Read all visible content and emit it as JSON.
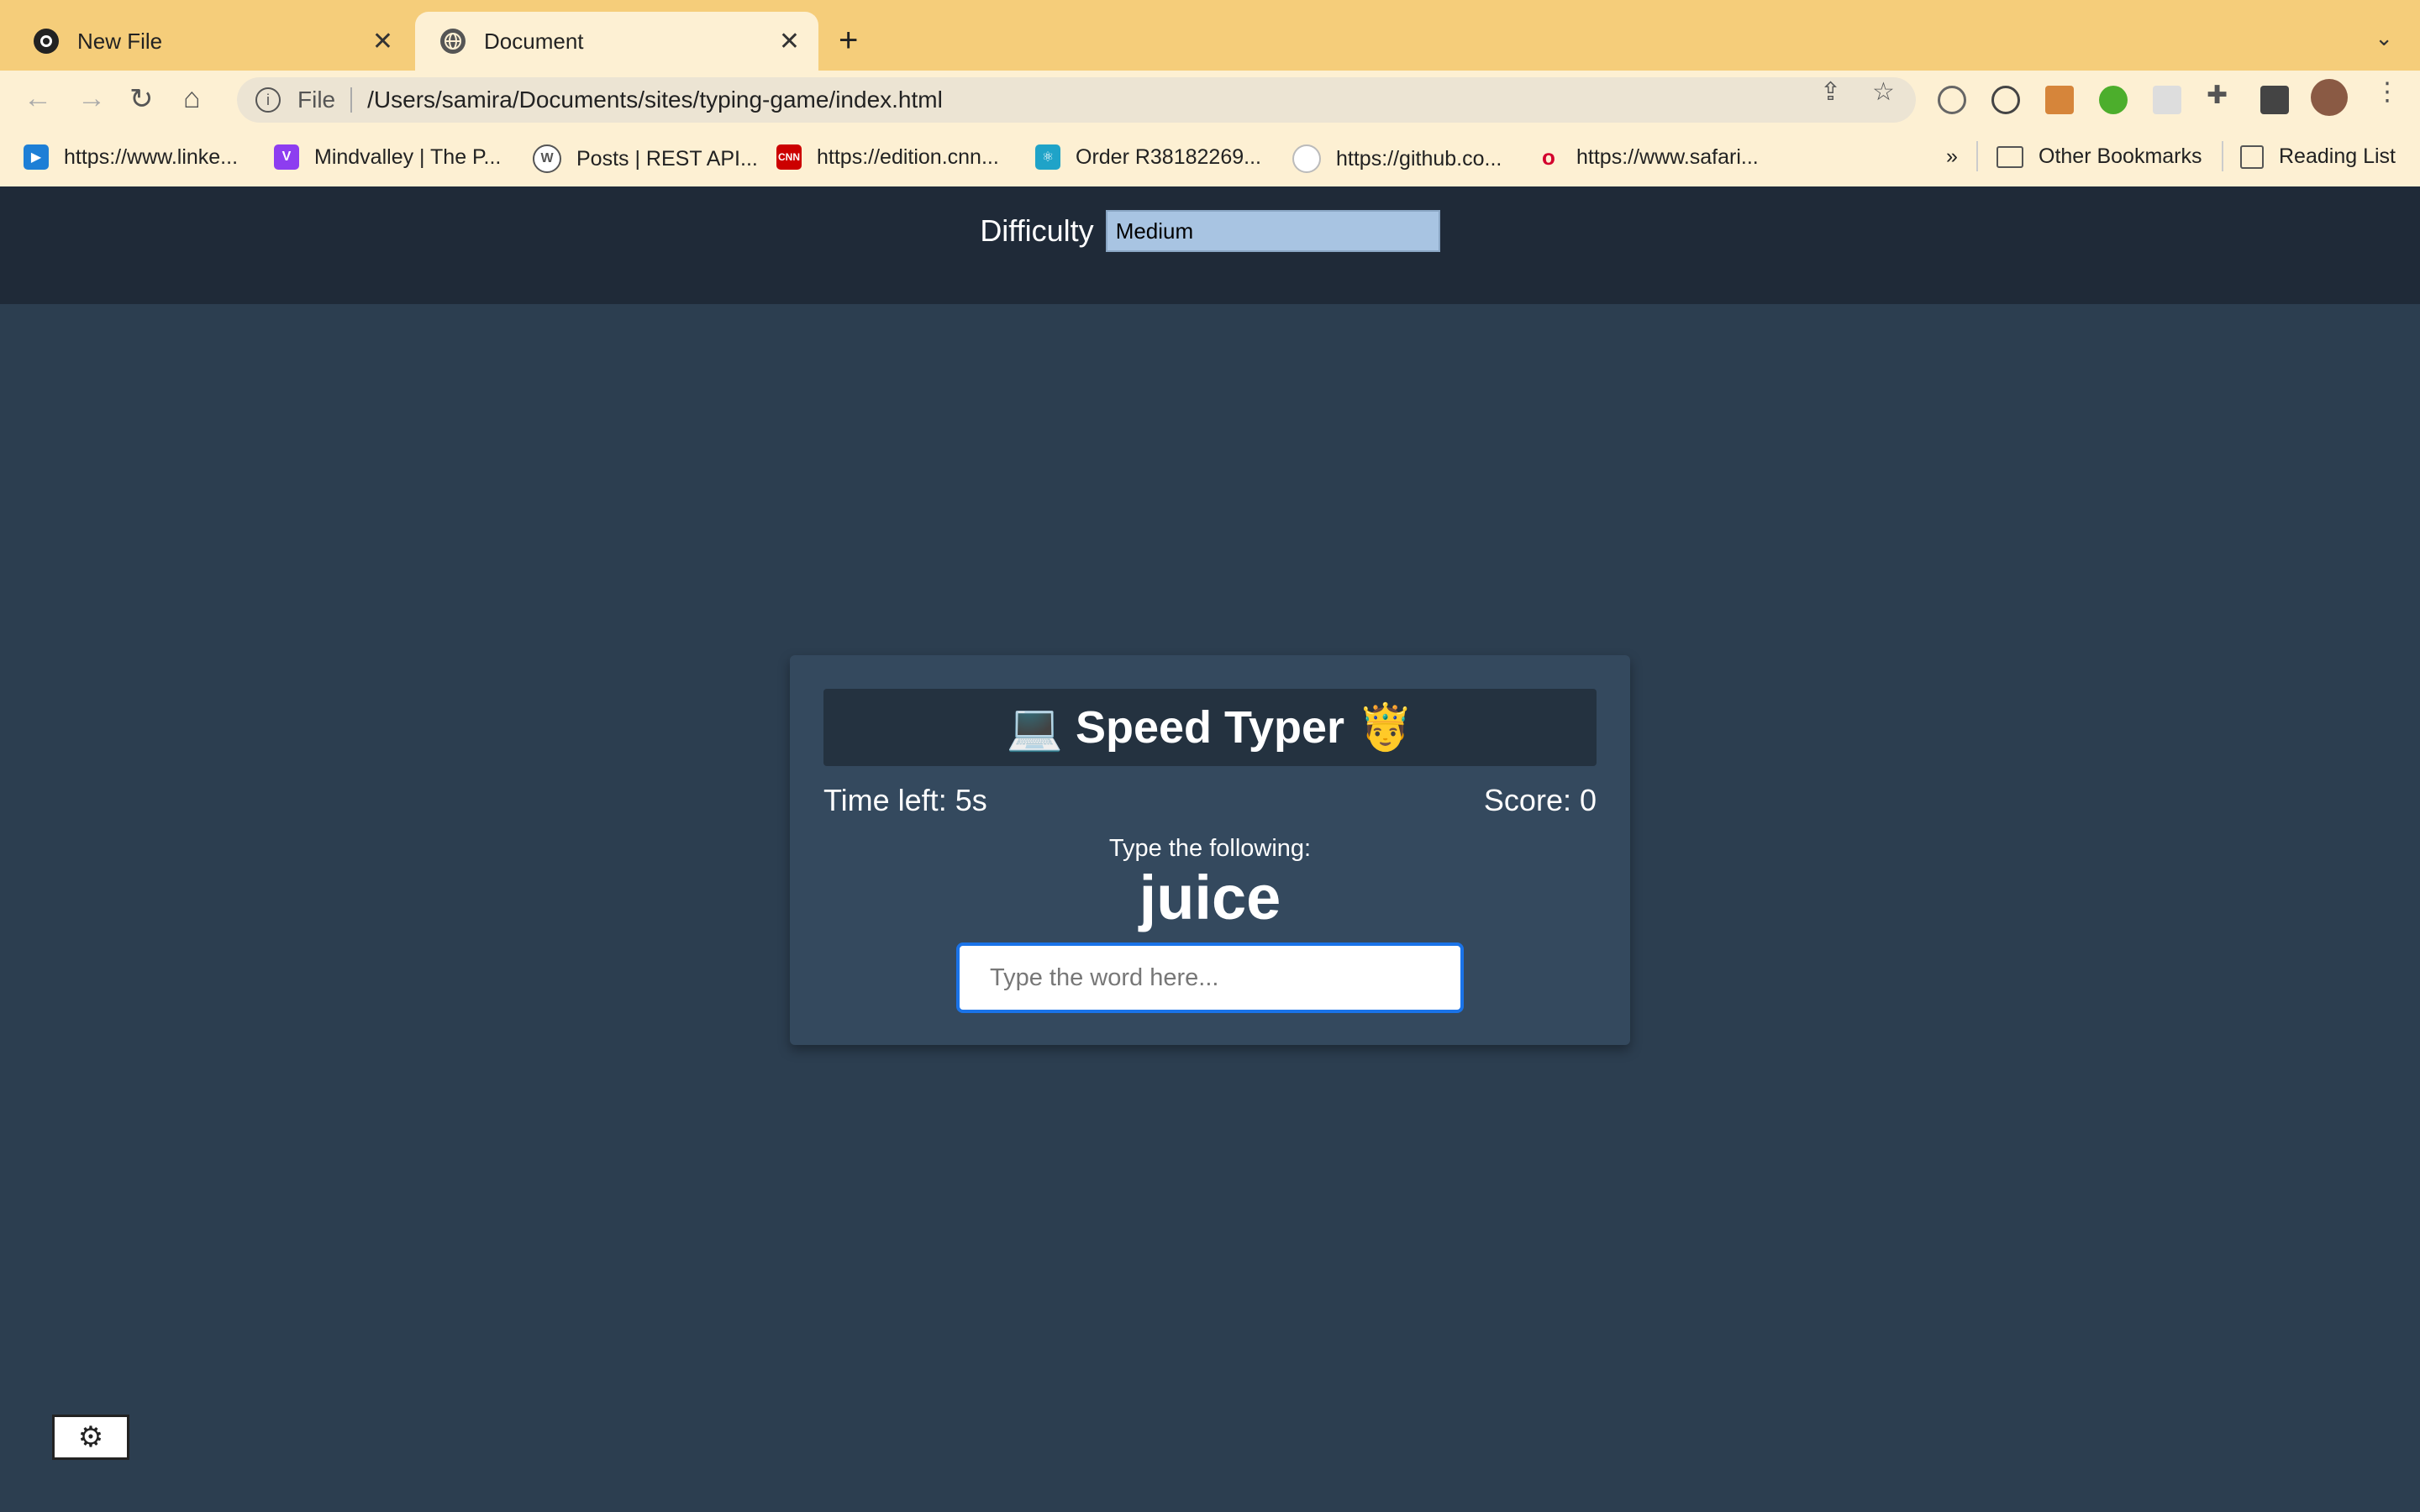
{
  "browser": {
    "tabs": [
      {
        "title": "New File",
        "icon": "github-icon",
        "active": false
      },
      {
        "title": "Document",
        "icon": "globe-icon",
        "active": true
      }
    ],
    "address": {
      "scheme": "File",
      "url": "/Users/samira/Documents/sites/typing-game/index.html"
    },
    "bookmarks": [
      {
        "label": "https://www.linke...",
        "icon": "video-icon",
        "color": "#1d7fd6"
      },
      {
        "label": "Mindvalley | The P...",
        "icon": "mindvalley-icon",
        "color": "#8d3df0"
      },
      {
        "label": "Posts | REST API...",
        "icon": "wordpress-icon",
        "color": "#555555"
      },
      {
        "label": "https://edition.cnn...",
        "icon": "cnn-icon",
        "color": "#cc0000"
      },
      {
        "label": "Order R38182269...",
        "icon": "react-icon",
        "color": "#1fa3c8"
      },
      {
        "label": "https://github.co...",
        "icon": "github-icon",
        "color": "#ffffff"
      },
      {
        "label": "https://www.safari...",
        "icon": "oreilly-icon",
        "color": "#d3002d"
      }
    ],
    "overflow": "»",
    "other_bookmarks": "Other Bookmarks",
    "reading_list": "Reading List"
  },
  "game": {
    "difficulty_label": "Difficulty",
    "difficulty_value": "Medium",
    "title": "💻 Speed Typer 🤴",
    "time_left": "Time left: 5s",
    "score": "Score: 0",
    "prompt": "Type the following:",
    "word": "juice",
    "input_placeholder": "Type the word here..."
  },
  "settings_icon": "gear-icon"
}
